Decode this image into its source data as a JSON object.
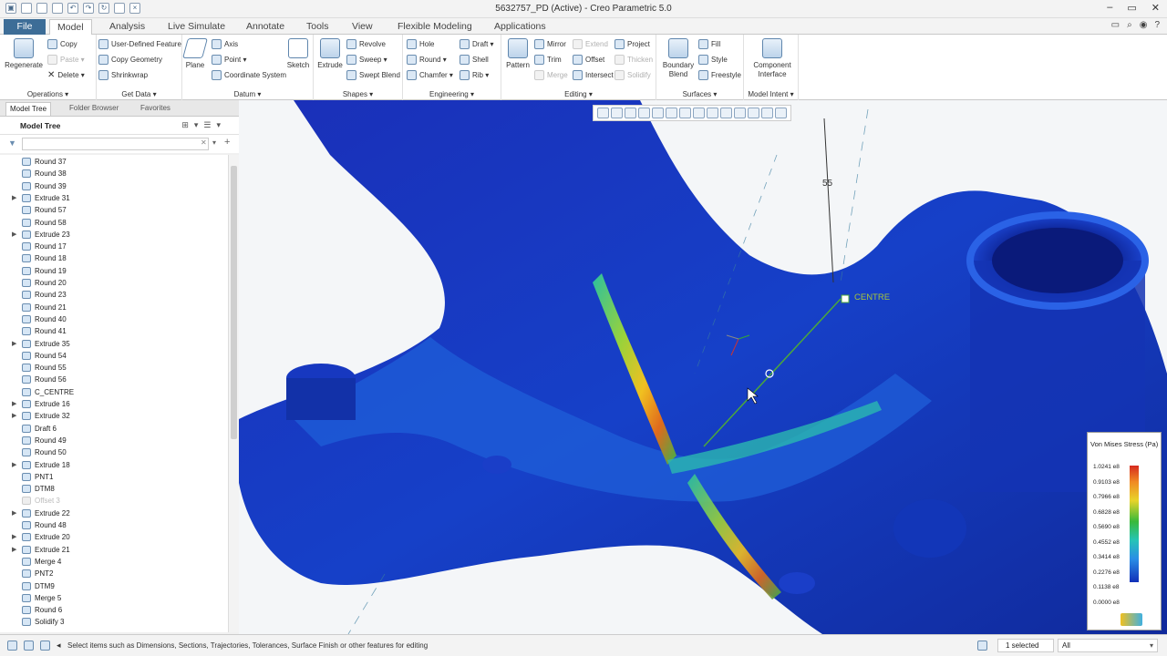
{
  "window": {
    "title": "5632757_PD (Active) - Creo Parametric 5.0",
    "controls": [
      "–",
      "▭",
      "✕"
    ]
  },
  "tabs": [
    "File",
    "Model",
    "Analysis",
    "Live Simulate",
    "Annotate",
    "Tools",
    "View",
    "Flexible Modeling",
    "Applications"
  ],
  "ribbon": {
    "operations": {
      "label": "Operations ▾",
      "regenerate": "Regenerate",
      "copy": "Copy",
      "paste": "Paste ▾",
      "delete": "Delete ▾"
    },
    "get_data": {
      "label": "Get Data ▾",
      "udf": "User-Defined Feature",
      "copy_geometry": "Copy Geometry",
      "shrinkwrap": "Shrinkwrap"
    },
    "datum": {
      "label": "Datum ▾",
      "plane": "Plane",
      "axis": "Axis",
      "point": "Point ▾",
      "coordinate_system": "Coordinate System",
      "sketch": "Sketch"
    },
    "shapes": {
      "label": "Shapes ▾",
      "extrude": "Extrude",
      "revolve": "Revolve",
      "sweep": "Sweep ▾",
      "swept_blend": "Swept Blend"
    },
    "engineering": {
      "label": "Engineering ▾",
      "hole": "Hole",
      "round": "Round ▾",
      "chamfer": "Chamfer ▾",
      "draft": "Draft ▾",
      "shell": "Shell",
      "rib": "Rib ▾"
    },
    "editing": {
      "label": "Editing ▾",
      "pattern": "Pattern",
      "mirror": "Mirror",
      "trim": "Trim",
      "merge": "Merge",
      "extend": "Extend",
      "offset": "Offset",
      "intersect": "Intersect",
      "project": "Project",
      "thicken": "Thicken",
      "solidify": "Solidify"
    },
    "surfaces": {
      "label": "Surfaces ▾",
      "boundary_blend": "Boundary Blend",
      "fill": "Fill",
      "style": "Style",
      "freestyle": "Freestyle"
    },
    "model_intent": {
      "label": "Model Intent ▾",
      "component_interface": "Component Interface"
    }
  },
  "left_panel": {
    "tabs": [
      "Model Tree",
      "Folder Browser",
      "Favorites"
    ],
    "tree_title": "Model Tree",
    "items": [
      {
        "label": "Round 37",
        "exp": ""
      },
      {
        "label": "Round 38",
        "exp": ""
      },
      {
        "label": "Round 39",
        "exp": ""
      },
      {
        "label": "Extrude 31",
        "exp": "▶"
      },
      {
        "label": "Round 57",
        "exp": ""
      },
      {
        "label": "Round 58",
        "exp": ""
      },
      {
        "label": "Extrude 23",
        "exp": "▶"
      },
      {
        "label": "Round 17",
        "exp": ""
      },
      {
        "label": "Round 18",
        "exp": ""
      },
      {
        "label": "Round 19",
        "exp": ""
      },
      {
        "label": "Round 20",
        "exp": ""
      },
      {
        "label": "Round 23",
        "exp": ""
      },
      {
        "label": "Round 21",
        "exp": ""
      },
      {
        "label": "Round 40",
        "exp": ""
      },
      {
        "label": "Round 41",
        "exp": ""
      },
      {
        "label": "Extrude 35",
        "exp": "▶"
      },
      {
        "label": "Round 54",
        "exp": ""
      },
      {
        "label": "Round 55",
        "exp": ""
      },
      {
        "label": "Round 56",
        "exp": ""
      },
      {
        "label": "C_CENTRE",
        "exp": ""
      },
      {
        "label": "Extrude 16",
        "exp": "▶"
      },
      {
        "label": "Extrude 32",
        "exp": "▶"
      },
      {
        "label": "Draft 6",
        "exp": ""
      },
      {
        "label": "Round 49",
        "exp": ""
      },
      {
        "label": "Round 50",
        "exp": ""
      },
      {
        "label": "Extrude 18",
        "exp": "▶"
      },
      {
        "label": "PNT1",
        "exp": ""
      },
      {
        "label": "DTM8",
        "exp": ""
      },
      {
        "label": "Offset 3",
        "exp": "",
        "grey": true
      },
      {
        "label": "Extrude 22",
        "exp": "▶"
      },
      {
        "label": "Round 48",
        "exp": ""
      },
      {
        "label": "Extrude 20",
        "exp": "▶"
      },
      {
        "label": "Extrude 21",
        "exp": "▶"
      },
      {
        "label": "Merge 4",
        "exp": ""
      },
      {
        "label": "PNT2",
        "exp": ""
      },
      {
        "label": "DTM9",
        "exp": ""
      },
      {
        "label": "Merge 5",
        "exp": ""
      },
      {
        "label": "Round 6",
        "exp": ""
      },
      {
        "label": "Solidify 3",
        "exp": ""
      }
    ]
  },
  "viewport": {
    "dimension": "55",
    "csys_label": "CENTRE",
    "legend": {
      "title": "Von Mises Stress (Pa)",
      "values": [
        "1.0241 e8",
        "0.9103 e8",
        "0.7966 e8",
        "0.6828 e8",
        "0.5690 e8",
        "0.4552 e8",
        "0.3414 e8",
        "0.2276 e8",
        "0.1138 e8",
        "0.0000 e8"
      ]
    }
  },
  "status": {
    "message": "Select items such as Dimensions, Sections, Trajectories, Tolerances, Surface Finish or other features for editing",
    "selected": "1 selected",
    "filter": "All"
  }
}
